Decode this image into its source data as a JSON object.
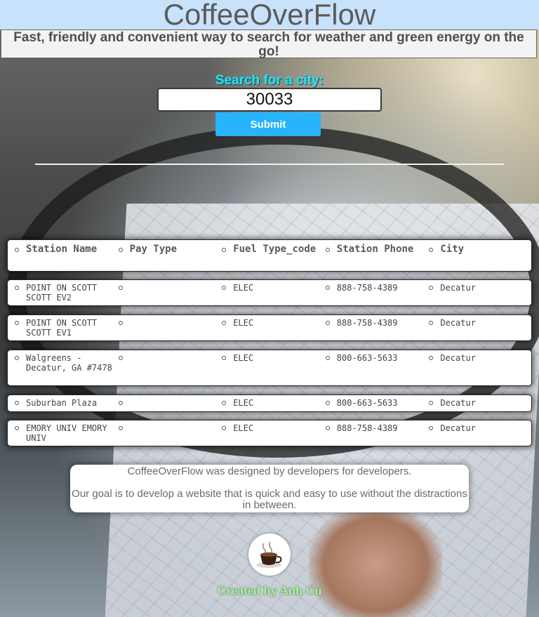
{
  "header": {
    "title": "CoffeeOverFlow",
    "tagline": "Fast, friendly and convenient way to search for weather and green energy on the go!"
  },
  "search": {
    "label": "Search for a city:",
    "value": "30033",
    "submit_label": "Submit"
  },
  "table": {
    "headers": [
      "Station Name",
      "Pay Type",
      "Fuel Type_code",
      "Station Phone",
      "City"
    ],
    "rows": [
      {
        "name": "POINT ON SCOTT SCOTT EV2",
        "pay": "",
        "fuel": "ELEC",
        "phone": "888-758-4389",
        "city": "Decatur"
      },
      {
        "name": "POINT ON SCOTT SCOTT EV1",
        "pay": "",
        "fuel": "ELEC",
        "phone": "888-758-4389",
        "city": "Decatur"
      },
      {
        "name": "Walgreens - Decatur, GA #7478",
        "pay": "",
        "fuel": "ELEC",
        "phone": "800-663-5633",
        "city": "Decatur"
      },
      {
        "name": "Suburban Plaza",
        "pay": "",
        "fuel": "ELEC",
        "phone": "800-663-5633",
        "city": "Decatur"
      },
      {
        "name": "EMORY UNIV EMORY UNIV",
        "pay": "",
        "fuel": "ELEC",
        "phone": "888-758-4389",
        "city": "Decatur"
      }
    ]
  },
  "about": {
    "line1": "CoffeeOverFlow was designed by developers for developers.",
    "line2": "Our goal is to develop a website that is quick and easy to use without the distractions in between."
  },
  "footer": {
    "credit": "Created by Anh Cu",
    "avatar_icon": "coffee-cup-icon"
  },
  "colors": {
    "header_bg": "#c8e2fb",
    "search_label": "#22e7ff",
    "submit_bg": "#27b4fb",
    "credit": "#a9f59b"
  }
}
